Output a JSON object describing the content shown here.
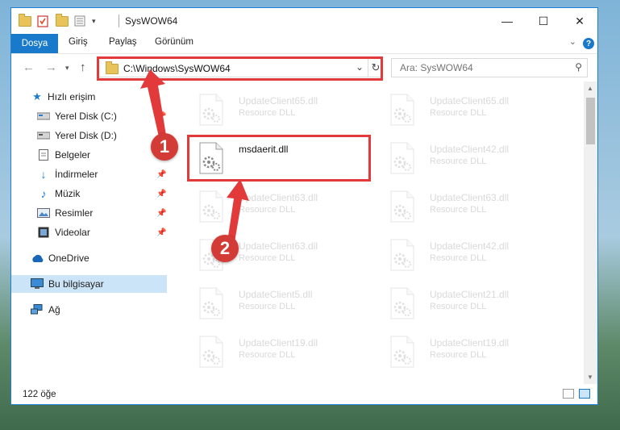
{
  "window": {
    "title": "SysWOW64",
    "controls": {
      "minimize": "—",
      "maximize": "☐",
      "close": "✕"
    }
  },
  "ribbon": {
    "tabs": [
      "Dosya",
      "Giriş",
      "Paylaş",
      "Görünüm"
    ],
    "help_label": "?"
  },
  "nav": {
    "address_path": "C:\\Windows\\SysWOW64",
    "search_placeholder": "Ara: SysWOW64"
  },
  "sidebar": {
    "items": [
      {
        "label": "Hızlı erişim",
        "icon": "star-icon"
      },
      {
        "label": "Yerel Disk (C:)",
        "icon": "drive-icon"
      },
      {
        "label": "Yerel Disk (D:)",
        "icon": "drive-icon"
      },
      {
        "label": "Belgeler",
        "icon": "documents-icon"
      },
      {
        "label": "İndirmeler",
        "icon": "download-icon"
      },
      {
        "label": "Müzik",
        "icon": "music-icon"
      },
      {
        "label": "Resimler",
        "icon": "pictures-icon"
      },
      {
        "label": "Videolar",
        "icon": "videos-icon"
      },
      {
        "label": "OneDrive",
        "icon": "cloud-icon"
      },
      {
        "label": "Bu bilgisayar",
        "icon": "computer-icon"
      },
      {
        "label": "Ağ",
        "icon": "network-icon"
      }
    ]
  },
  "files": [
    {
      "name": "UpdateClient65.dll",
      "type": "Resource DLL"
    },
    {
      "name": "UpdateClient65.dll",
      "type": "Resource DLL"
    },
    {
      "name": "msdaerit.dll",
      "type": ""
    },
    {
      "name": "UpdateClient42.dll",
      "type": "Resource DLL"
    },
    {
      "name": "UpdateClient63.dll",
      "type": "Resource DLL"
    },
    {
      "name": "UpdateClient63.dll",
      "type": "Resource DLL"
    },
    {
      "name": "UpdateClient63.dll",
      "type": "Resource DLL"
    },
    {
      "name": "UpdateClient42.dll",
      "type": "Resource DLL"
    },
    {
      "name": "UpdateClient5.dll",
      "type": "Resource DLL"
    },
    {
      "name": "UpdateClient21.dll",
      "type": "Resource DLL"
    },
    {
      "name": "UpdateClient19.dll",
      "type": "Resource DLL"
    },
    {
      "name": "UpdateClient19.dll",
      "type": "Resource DLL"
    }
  ],
  "status": {
    "item_count": "122 öğe"
  },
  "annotations": {
    "step1": "1",
    "step2": "2",
    "color": "#d33b36"
  },
  "colors": {
    "accent": "#1979ca",
    "selected_bg": "#cce4f7"
  }
}
